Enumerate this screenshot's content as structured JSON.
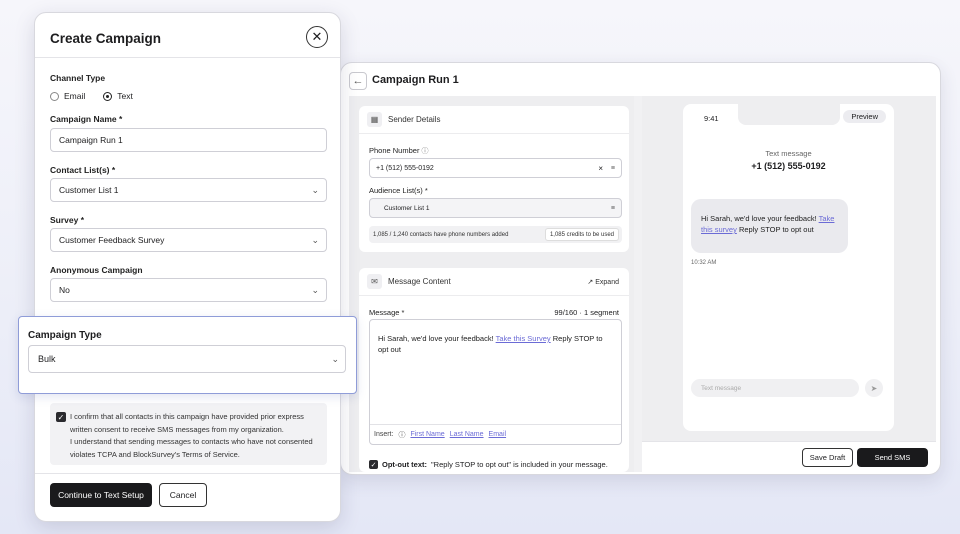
{
  "sms": {
    "title": "Campaign Run 1",
    "sender_details": "Sender Details",
    "phone_label": "Phone Number",
    "phone_value": "+1 (512) 555-0192",
    "audience_label": "Audience List(s) *",
    "audience_value": "Customer List 1",
    "contacts_info": "1,085 / 1,240 contacts have phone numbers added",
    "credits_info": "1,085 credits to be used",
    "message_content": "Message Content",
    "expand": "Expand",
    "message_label": "Message *",
    "segment_info": "99/160 · 1 segment",
    "message_text_pre": "Hi Sarah, we'd love your feedback!",
    "message_link": "Take this Survey",
    "message_text_post": "Reply STOP to opt out",
    "insert_label": "Insert:",
    "insert_first": "First Name",
    "insert_last": "Last Name",
    "insert_email": "Email",
    "optout_bold": "Opt-out text:",
    "optout_rest": "\"Reply STOP to opt out\" is included in your message.",
    "save_draft": "Save Draft",
    "send_sms": "Send SMS"
  },
  "phone_preview": {
    "time": "9:41",
    "preview_tag": "Preview",
    "text_message_label": "Text message",
    "number": "+1 (512) 555-0192",
    "bubble_pre": "Hi Sarah, we'd love your feedback!",
    "bubble_link": "Take this survey",
    "bubble_post": "Reply STOP to opt out",
    "bubble_time": "10:32 AM",
    "input_placeholder": "Text message"
  },
  "modal": {
    "title": "Create Campaign",
    "channel_label": "Channel Type",
    "channel_options": [
      "Email",
      "Text"
    ],
    "channel_selected": "Text",
    "name_label": "Campaign Name *",
    "name_value": "Campaign Run 1",
    "contacts_label": "Contact List(s) *",
    "contacts_value": "Customer List 1",
    "survey_label": "Survey *",
    "survey_value": "Customer Feedback Survey",
    "anon_label": "Anonymous Campaign",
    "anon_value": "No",
    "type_label": "Campaign Type",
    "type_value": "Bulk",
    "consent_text_1": "I confirm that all contacts in this campaign have provided prior express written consent to receive SMS messages from my organization.",
    "consent_text_2": "I understand that sending messages to contacts who have not consented violates TCPA and BlockSurvey's Terms of Service.",
    "continue_button": "Continue to Text Setup",
    "cancel_button": "Cancel"
  }
}
